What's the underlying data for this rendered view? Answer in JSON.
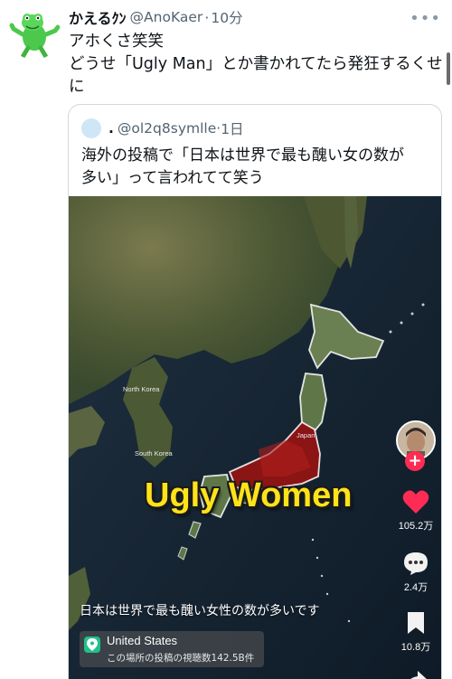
{
  "tweet": {
    "display_name": "かえるｸﾝ",
    "handle": "@AnoKaer",
    "separator": "·",
    "time": "10分",
    "more_label": "•••",
    "lines": [
      "アホくさ笑笑",
      "どうせ「Ugly Man」とか書かれてたら発狂するくせ",
      "に"
    ]
  },
  "quote": {
    "display_name": ".",
    "handle": "@ol2q8symlle",
    "separator": "·",
    "time": "1日",
    "lines": [
      "海外の投稿で「日本は世界で最も醜い女の数が",
      "多い」って言われてて笑う"
    ]
  },
  "video": {
    "overlay_title": "Ugly Women",
    "map_labels": {
      "north_korea": "North Korea",
      "south_korea": "South Korea",
      "japan": "Japan"
    },
    "plus_label": "+",
    "likes": "105.2万",
    "comments": "2.4万",
    "saves": "10.8万",
    "caption": "日本は世界で最も醜い女性の数が多いです",
    "location": {
      "name": "United States",
      "views": "この場所の投稿の視聴数142.5B件"
    }
  },
  "colors": {
    "highlight": "#ffe31a",
    "japan_fill": "#8b1414",
    "like": "#fe2c55",
    "location_pin": "#21c08b"
  }
}
